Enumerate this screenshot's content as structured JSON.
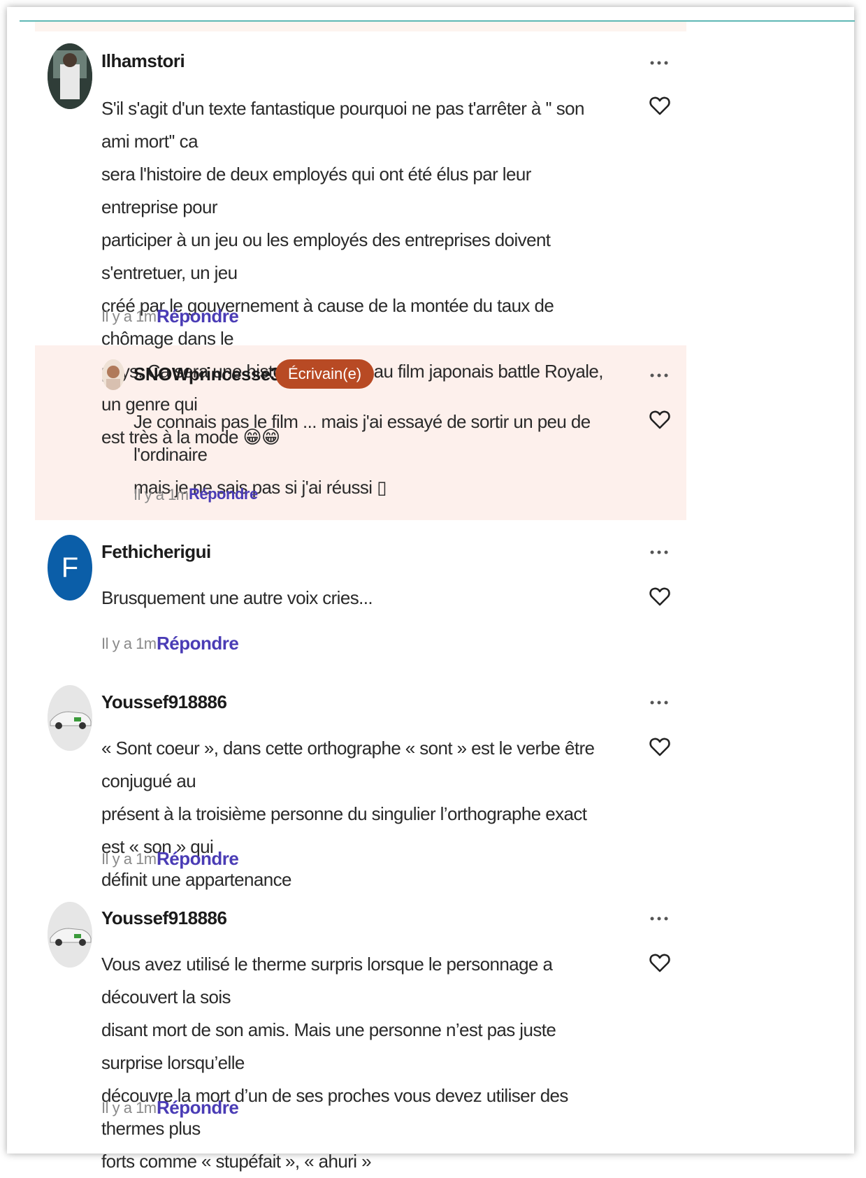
{
  "comments": [
    {
      "username": "Ilhamstori",
      "text_lines": [
        "S'il s'agit d'un texte fantastique pourquoi ne pas t'arrêter à '' son ami mort'' ca",
        "sera l'histoire de deux employés qui ont été élus par leur entreprise pour",
        "participer à un jeu ou les employés des entreprises doivent s'entretuer, un jeu",
        "créé par le gouvernement à cause de la montée du taux de chômage dans le",
        "pays. Ca sera une histoire similaire au film japonais battle Royale, un genre qui",
        "est très à la mode 😁😁"
      ],
      "time": "Il y a 1m",
      "reply_label": "Répondre"
    },
    {
      "username": "SNOWprincesse360",
      "badge": "Écrivain(e)",
      "text_lines": [
        "Je connais pas le film ... mais j'ai essayé de sortir un peu de l'ordinaire",
        "mais je ne sais pas si j'ai réussi ▯"
      ],
      "time": "Il y a 1m",
      "reply_label": "Répondre"
    },
    {
      "username": "Fethicherigui",
      "avatar_letter": "F",
      "text_lines": [
        "Brusquement une autre voix cries..."
      ],
      "time": "Il y a 1m",
      "reply_label": "Répondre"
    },
    {
      "username": "Youssef918886",
      "text_lines": [
        "« Sont coeur », dans cette orthographe « sont » est le verbe être conjugué au",
        "présent à la troisième personne du singulier l’orthographe exact est « son » qui",
        "définit une appartenance"
      ],
      "time": "Il y a 1m",
      "reply_label": "Répondre"
    },
    {
      "username": "Youssef918886",
      "text_lines": [
        "Vous avez utilisé le therme surpris lorsque le personnage a découvert la sois",
        "disant mort de son amis. Mais une personne n’est pas juste surprise lorsqu’elle",
        "découvre la mort d’un de ses proches vous devez utiliser des thermes plus",
        "forts comme « stupéfait », « ahuri »"
      ],
      "time": "Il y a 1m",
      "reply_label": "Répondre"
    }
  ],
  "colors": {
    "accent_line": "#5fb8b5",
    "reply_background": "#fdf0ec",
    "badge": "#b84a24",
    "reply_link": "#4a3cb5",
    "letter_avatar": "#0b5ea8"
  },
  "icons": [
    "more-options-icon",
    "heart-icon"
  ]
}
